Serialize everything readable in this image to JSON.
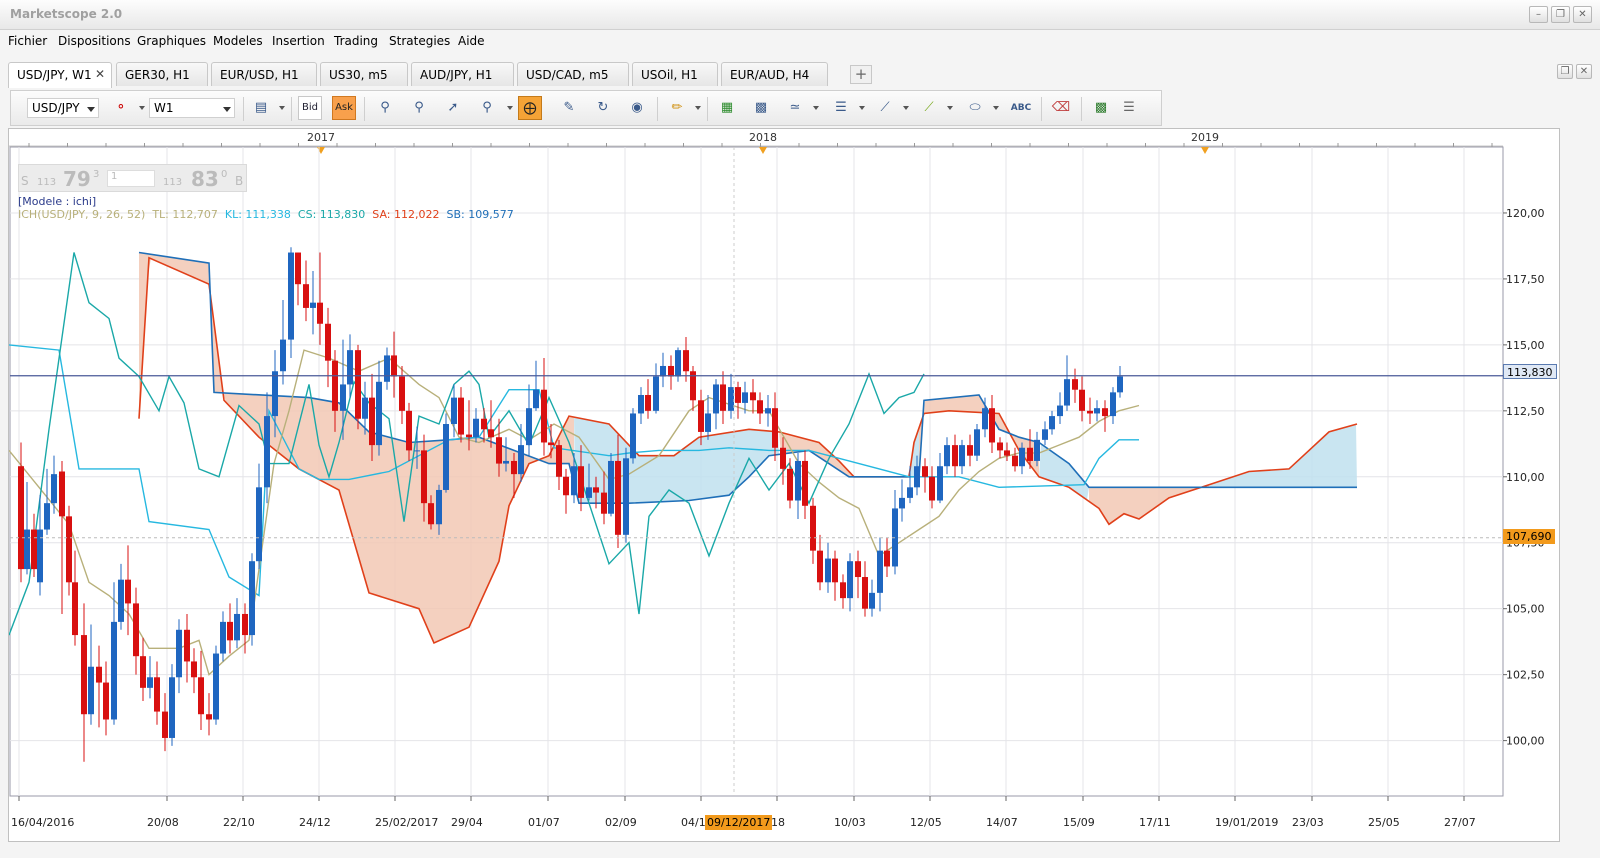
{
  "app": {
    "title": "Marketscope 2.0",
    "window_buttons": [
      "minimize-icon",
      "restore-icon",
      "close-icon"
    ]
  },
  "menu": [
    "Fichier",
    "Dispositions",
    "Graphiques",
    "Modeles",
    "Insertion",
    "Trading",
    "Strategies",
    "Aide"
  ],
  "tabs": [
    {
      "label": "USD/JPY, W1",
      "active": true,
      "closable": true
    },
    {
      "label": "GER30, H1",
      "active": false
    },
    {
      "label": "EUR/USD, H1",
      "active": false
    },
    {
      "label": "US30, m5",
      "active": false
    },
    {
      "label": "AUD/JPY, H1",
      "active": false
    },
    {
      "label": "USD/CAD, m5",
      "active": false
    },
    {
      "label": "USOil, H1",
      "active": false
    },
    {
      "label": "EUR/AUD, H4",
      "active": false
    }
  ],
  "toolbar": {
    "instrument": "USD/JPY",
    "timeframe": "W1",
    "bid_label": "Bid",
    "ask_label": "Ask"
  },
  "chart": {
    "years": [
      "2017",
      "2018",
      "2019"
    ],
    "quote_widget": {
      "sell_prefix": "S",
      "sell_big": "113",
      "sell_pips": "79",
      "sell_frac": "3",
      "amount": "1",
      "buy_big": "113",
      "buy_pips": "83",
      "buy_frac": "0",
      "buy_suffix": "B"
    },
    "template_label": "[Modele : ichi]",
    "indicator": {
      "name": "ICH(USD/JPY, 9, 26, 52)",
      "tl": "TL: 112,707",
      "kl": "KL: 111,338",
      "cs": "CS: 113,830",
      "sa": "SA: 112,022",
      "sb": "SB: 109,577",
      "colors": {
        "tl": "#b8b07a",
        "kl": "#26b8e0",
        "cs": "#1aa8a8",
        "sa": "#e0401a",
        "sb": "#1f6fb8"
      }
    },
    "current_price": "113,830",
    "crosshair_price": "107,690",
    "crosshair_date": "09/12/2017",
    "x_labels": [
      "16/04/2016",
      "20/08",
      "22/10",
      "24/12",
      "25/02/2017",
      "29/04",
      "01/07",
      "02/09",
      "04/1",
      "2018",
      "10/03",
      "12/05",
      "14/07",
      "15/09",
      "17/11",
      "19/01/2019",
      "23/03",
      "25/05",
      "27/07"
    ]
  },
  "chart_data": {
    "type": "candlestick",
    "y_axis": {
      "ticks": [
        "100,00",
        "102,50",
        "105,00",
        "107,50",
        "110,00",
        "112,50",
        "115,00",
        "117,50",
        "120,00"
      ],
      "range": [
        97.9,
        122.5
      ]
    },
    "colors": {
      "up": "#1f66c0",
      "down": "#d81010",
      "kumo_bear": "#f2c8b4",
      "kumo_bull": "#bfe0ee"
    }
  }
}
